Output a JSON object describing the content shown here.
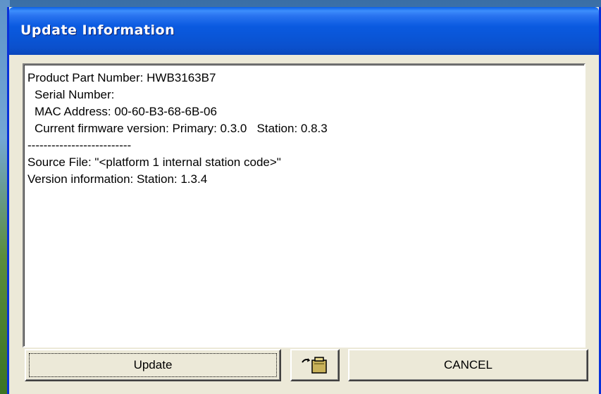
{
  "window": {
    "title": "Update Information"
  },
  "info": {
    "product_part_number": "Product Part Number: HWB3163B7",
    "serial_number": "Serial Number:",
    "mac_address": "MAC Address: 00-60-B3-68-6B-06",
    "current_firmware": "Current firmware version: Primary: 0.3.0   Station: 0.8.3",
    "separator": "--------------------------",
    "source_file": "Source File: \"<platform 1 internal station code>\"",
    "version_information": "Version information: Station: 1.3.4"
  },
  "buttons": {
    "update_label": "Update",
    "file_icon": "open-file-icon",
    "cancel_label": "CANCEL"
  }
}
